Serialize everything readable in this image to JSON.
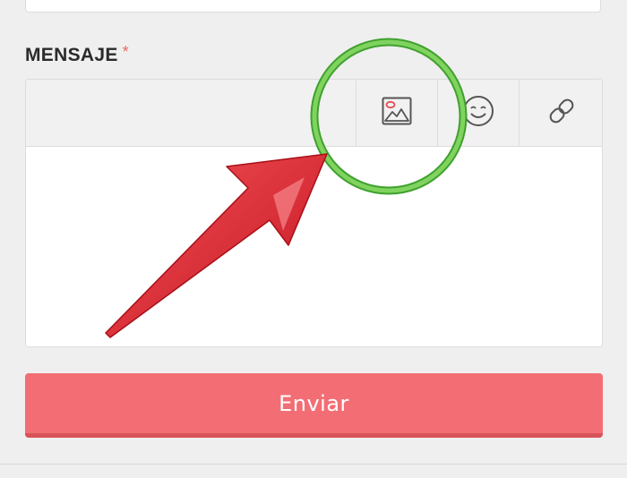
{
  "form": {
    "message_label": "MENSAJE",
    "required_marker": "*",
    "submit_label": "Enviar"
  },
  "toolbar": {
    "buttons": [
      {
        "name": "insert-image",
        "icon": "image-icon"
      },
      {
        "name": "insert-emoji",
        "icon": "smiley-icon"
      },
      {
        "name": "insert-link",
        "icon": "link-icon"
      }
    ]
  },
  "annotation": {
    "highlight_color": "#6cc24a",
    "arrow_color": "#e3262f"
  },
  "colors": {
    "background": "#efefef",
    "submit_button": "#f26e74",
    "required_marker": "#e86a6a"
  }
}
